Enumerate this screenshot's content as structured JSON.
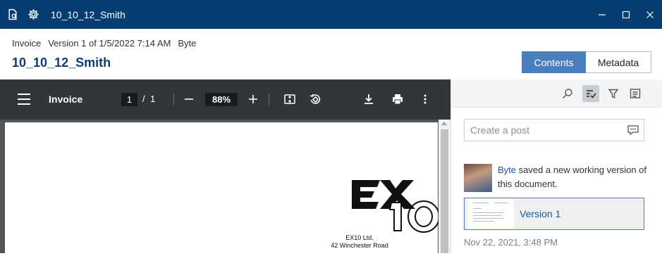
{
  "window": {
    "title": "10_10_12_Smith",
    "icons": [
      "document-view-icon",
      "gear-icon"
    ],
    "controls": [
      "minimize-icon",
      "maximize-icon",
      "close-icon"
    ]
  },
  "header": {
    "doc_type": "Invoice",
    "version_info": "Version 1 of 1/5/2022 7:14 AM",
    "author": "Byte",
    "title": "10_10_12_Smith",
    "tabs": [
      {
        "label": "Contents",
        "active": true
      },
      {
        "label": "Metadata",
        "active": false
      }
    ]
  },
  "viewer": {
    "title": "Invoice",
    "current_page": "1",
    "separator": "/",
    "total_pages": "1",
    "zoom": "88%",
    "icons": [
      "menu-icon",
      "zoom-out-icon",
      "zoom-in-icon",
      "fit-page-icon",
      "rotate-icon",
      "download-icon",
      "print-icon",
      "more-icon"
    ]
  },
  "document": {
    "logo_text": "EX10",
    "company": "EX10 Ltd.",
    "address": "42 Winchester Road"
  },
  "panel": {
    "toolbar_icons": [
      "search-icon",
      "check-list-icon",
      "filter-icon",
      "details-icon"
    ],
    "post_placeholder": "Create a post",
    "activity": {
      "user": "Byte",
      "text": " saved a new working version of this document."
    },
    "version_label": "Version 1",
    "timestamp": "Nov 22, 2021, 3:48 PM"
  },
  "colors": {
    "titlebar": "#063d73",
    "accent": "#4a7fbd",
    "link": "#1b5aa3",
    "viewer_toolbar": "#323639"
  }
}
